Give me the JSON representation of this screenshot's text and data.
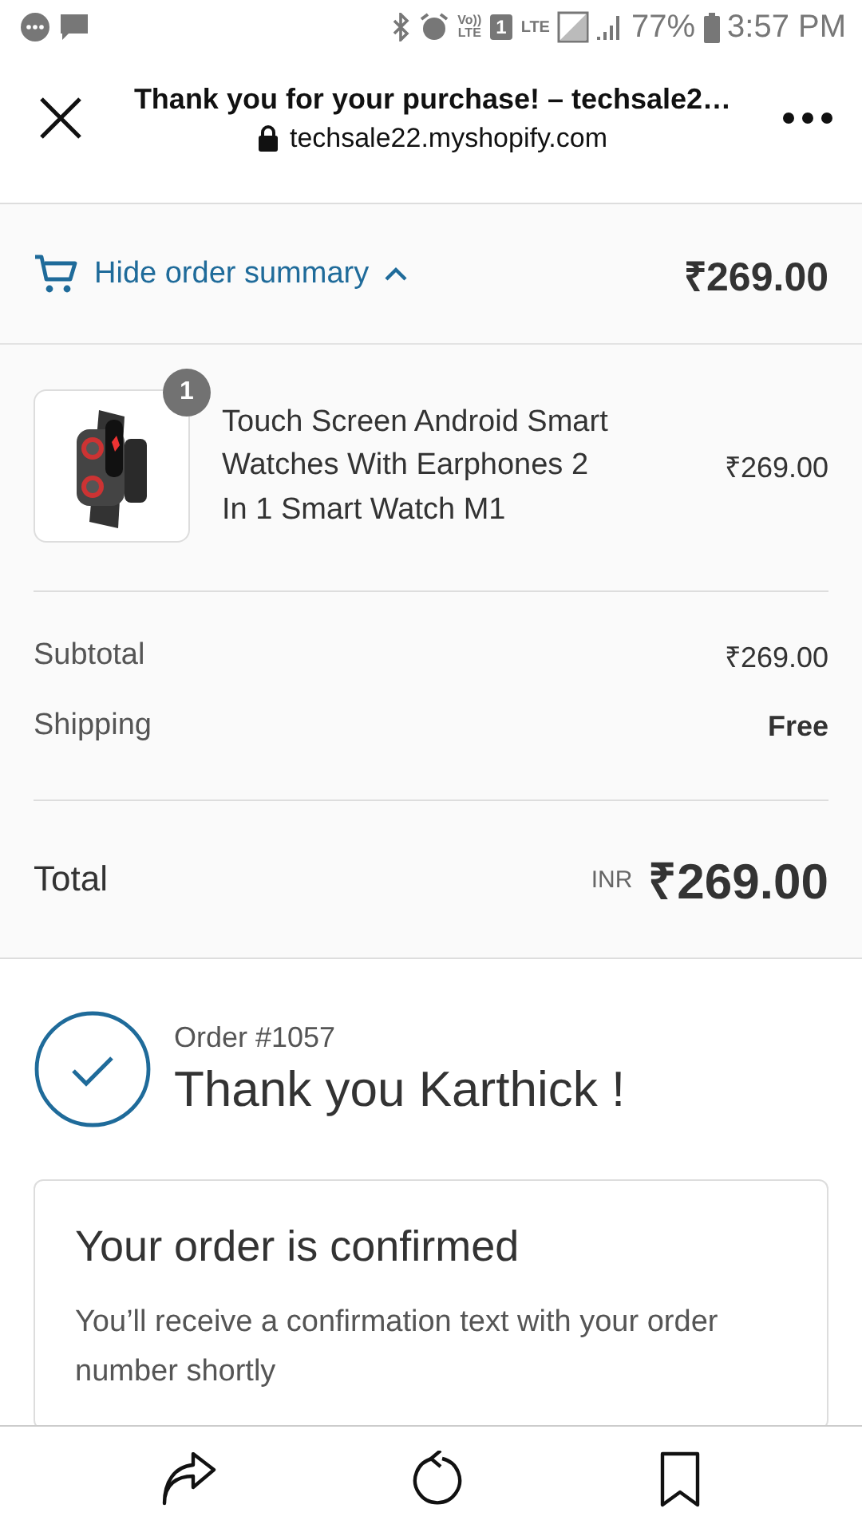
{
  "status_bar": {
    "volte_top": "Vo))",
    "volte_bottom": "LTE",
    "sim": "1",
    "network": "LTE",
    "battery": "77%",
    "time": "3:57 PM"
  },
  "browser": {
    "title": "Thank you for your purchase! – techsale2…",
    "url": "techsale22.myshopify.com"
  },
  "summary_toggle": {
    "label": "Hide order summary",
    "expanded": true,
    "total": "₹269.00"
  },
  "items": [
    {
      "name": "Touch Screen Android Smart Watches With Earphones 2 In 1 Smart Watch M1",
      "quantity": "1",
      "price": "₹269.00"
    }
  ],
  "lines": [
    {
      "label": "Subtotal",
      "value": "₹269.00",
      "strong": false
    },
    {
      "label": "Shipping",
      "value": "Free",
      "strong": true
    }
  ],
  "total": {
    "label": "Total",
    "currency": "INR",
    "amount": "₹269.00"
  },
  "order": {
    "number": "Order #1057",
    "greeting": "Thank you Karthick !"
  },
  "confirmation": {
    "title": "Your order is confirmed",
    "text": "You’ll receive a confirmation text with your order number shortly"
  }
}
